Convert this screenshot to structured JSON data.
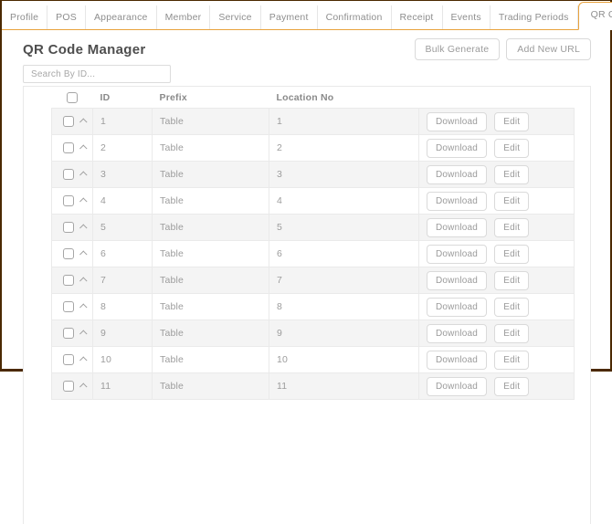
{
  "tabs": {
    "items": [
      {
        "label": "Profile",
        "active": false
      },
      {
        "label": "POS",
        "active": false
      },
      {
        "label": "Appearance",
        "active": false
      },
      {
        "label": "Member",
        "active": false
      },
      {
        "label": "Service",
        "active": false
      },
      {
        "label": "Payment",
        "active": false
      },
      {
        "label": "Confirmation",
        "active": false
      },
      {
        "label": "Receipt",
        "active": false
      },
      {
        "label": "Events",
        "active": false
      },
      {
        "label": "Trading Periods",
        "active": false
      },
      {
        "label": "QR Code Manager",
        "active": true
      }
    ]
  },
  "header": {
    "title": "QR Code Manager",
    "bulk_generate_label": "Bulk Generate",
    "add_new_url_label": "Add New URL"
  },
  "search": {
    "placeholder": "Search By ID..."
  },
  "table": {
    "columns": {
      "id": "ID",
      "prefix": "Prefix",
      "location": "Location No"
    },
    "row_actions": {
      "download": "Download",
      "edit": "Edit"
    },
    "rows": [
      {
        "id": "1",
        "prefix": "Table",
        "location": "1"
      },
      {
        "id": "2",
        "prefix": "Table",
        "location": "2"
      },
      {
        "id": "3",
        "prefix": "Table",
        "location": "3"
      },
      {
        "id": "4",
        "prefix": "Table",
        "location": "4"
      },
      {
        "id": "5",
        "prefix": "Table",
        "location": "5"
      },
      {
        "id": "6",
        "prefix": "Table",
        "location": "6"
      },
      {
        "id": "7",
        "prefix": "Table",
        "location": "7"
      },
      {
        "id": "8",
        "prefix": "Table",
        "location": "8"
      },
      {
        "id": "9",
        "prefix": "Table",
        "location": "9"
      },
      {
        "id": "10",
        "prefix": "Table",
        "location": "10"
      },
      {
        "id": "11",
        "prefix": "Table",
        "location": "11"
      }
    ]
  },
  "colors": {
    "accent_orange": "#e9a23c",
    "frame_brown": "#4b2900",
    "row_stripe": "#f4f4f4"
  }
}
